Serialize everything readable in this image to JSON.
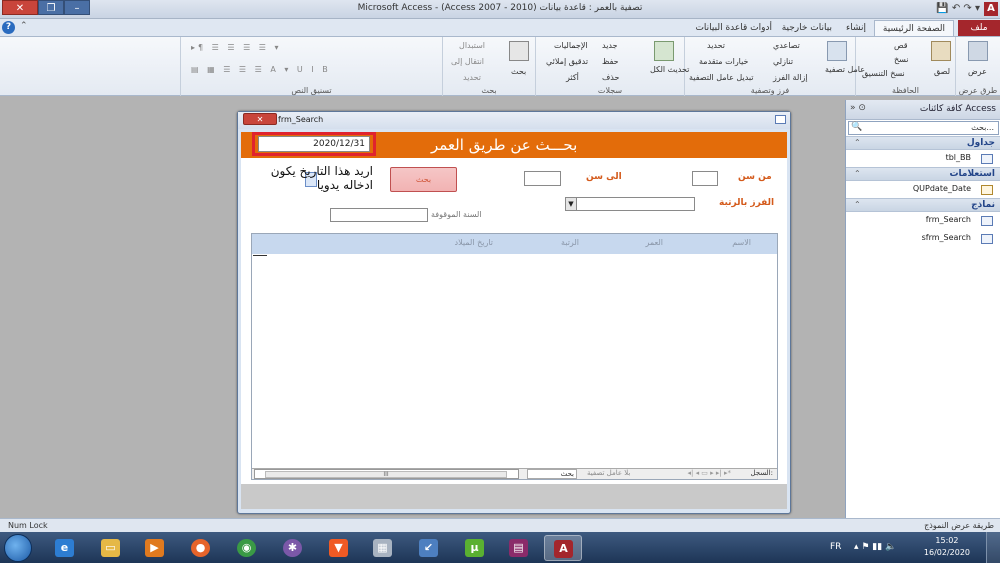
{
  "window": {
    "title": "Microsoft Access - (Access 2007 - 2010) تصفية بالعمر : قاعدة بيانات"
  },
  "ribbon_tabs": {
    "file": "ملف",
    "home": "الصفحة الرئيسية",
    "create": "إنشاء",
    "external_data": "بيانات خارجية",
    "db_tools": "أدوات قاعدة البيانات"
  },
  "ribbon": {
    "views": {
      "label": "طرق عرض",
      "view_btn": "عرض"
    },
    "clipboard": {
      "label": "الحافظة",
      "paste": "لصق",
      "cut": "قص",
      "copy": "نسخ",
      "format_painter": "نسخ التنسيق"
    },
    "sort_filter": {
      "label": "فرز وتصفية",
      "filter": "عامل تصفية",
      "ascending": "تصاعدي",
      "descending": "تنازلي",
      "remove_sort": "إزالة الفرز",
      "selection": "تحديد",
      "advanced": "خيارات متقدمة",
      "toggle_filter": "تبديل عامل التصفية"
    },
    "records": {
      "label": "سجلات",
      "refresh": "تحديث الكل",
      "new": "جديد",
      "save": "حفظ",
      "delete": "حذف",
      "totals": "الإجماليات",
      "spelling": "تدقيق إملائي",
      "more": "أكثر"
    },
    "find": {
      "label": "بحث",
      "find": "بحث",
      "replace": "استبدال",
      "goto": "انتقال إلى",
      "select": "تحديد"
    },
    "text_format": {
      "label": "تسنيق النص"
    }
  },
  "nav_pane": {
    "title": "كافة كائنات Access",
    "search_placeholder": "بحث...",
    "groups": [
      {
        "label": "جداول",
        "items": [
          "tbl_BB"
        ]
      },
      {
        "label": "استعلامات",
        "items": [
          "QUPdate_Date"
        ]
      },
      {
        "label": "نماذج",
        "items": [
          "frm_Search",
          "sfrm_Search"
        ]
      }
    ]
  },
  "form": {
    "window_title": "frm_Search",
    "header_title": "بحـــث عن طريق العمر",
    "date_value": "2020/12/31",
    "from_age_label": "من سن",
    "to_age_label": "الى سن",
    "sort_by_rank_label": "الفرز بالرتبة",
    "stopped_year_label": "السنة الموقوفة",
    "search_button": "بحث",
    "note_text": "اريد هذا التاريخ يكون ادخاله يدويا",
    "columns": [
      "الاسم",
      "العمر",
      "الرتبة",
      "تاريخ الميلاد"
    ],
    "record_nav": {
      "record_label": "السجل:",
      "no_filter": "بلا عامل تصفية",
      "search": "بحث"
    }
  },
  "status": {
    "left": "Num Lock",
    "right": "طريقة عرض النموذج"
  },
  "taskbar": {
    "lang": "FR",
    "time": "15:02",
    "date": "16/02/2020"
  }
}
